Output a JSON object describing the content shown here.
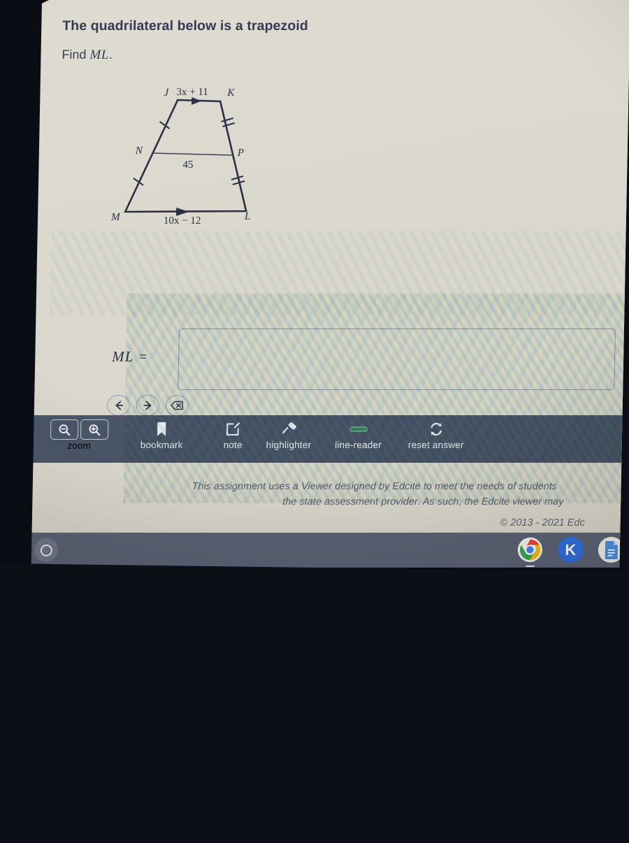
{
  "question": {
    "prompt": "The quadrilateral below is a trapezoid",
    "find_prefix": "Find",
    "find_target": "ML",
    "find_suffix": "."
  },
  "figure": {
    "shape": "trapezoid",
    "vertices": [
      "J",
      "K",
      "L",
      "M",
      "N",
      "P"
    ],
    "top_side_label": "3x + 11",
    "top_side_expression_a": "3x",
    "top_side_expression_b": "+ 11",
    "midsegment_label": "45",
    "bottom_side_label": "10x − 12",
    "labels": {
      "J": "J",
      "K": "K",
      "N": "N",
      "P": "P",
      "M": "M",
      "L": "L"
    },
    "tick_marks": {
      "left_leg": 1,
      "right_leg": 2
    }
  },
  "answer": {
    "label": "ML =",
    "value": "",
    "placeholder": ""
  },
  "nav": {
    "back_label": "←",
    "forward_label": "→",
    "backspace_label": "⌫"
  },
  "toolbar": {
    "zoom_label": "zoom",
    "zoom_out_icon": "magnifier-minus-icon",
    "zoom_in_icon": "magnifier-plus-icon",
    "items": [
      {
        "label": "bookmark",
        "icon": "bookmark-icon"
      },
      {
        "label": "note",
        "icon": "note-icon"
      },
      {
        "label": "highlighter",
        "icon": "highlighter-icon"
      },
      {
        "label": "line-reader",
        "icon": "line-reader-icon"
      },
      {
        "label": "reset answer",
        "icon": "refresh-icon"
      }
    ],
    "background_color": "#4a5668"
  },
  "footer": {
    "line1": "This assignment uses a Viewer designed by Edcite to meet the needs of students",
    "line2": "the state assessment provider. As such, the Edcite viewer may",
    "copyright": "© 2013 - 2021 Edc"
  },
  "shelf": {
    "launcher_icon": "launcher-circle-icon",
    "apps": [
      {
        "name": "chrome",
        "label": "",
        "icon": "chrome-icon",
        "active": true
      },
      {
        "name": "kami",
        "label": "K",
        "icon": "kami-icon",
        "active": false
      },
      {
        "name": "docs",
        "label": "",
        "icon": "google-docs-icon",
        "active": false
      }
    ],
    "background_color": "#5a6275"
  },
  "colors": {
    "page_background": "#dedbd0",
    "text": "#343a52",
    "toolbar": "#4a5668",
    "shelf": "#5a6275",
    "figure_stroke": "#2b3048"
  }
}
